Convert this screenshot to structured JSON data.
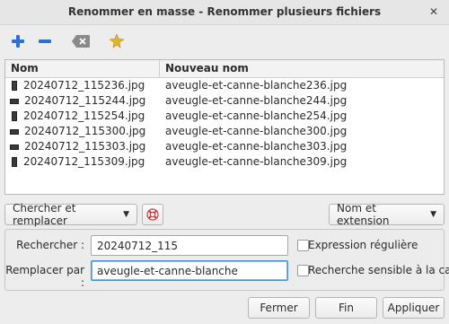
{
  "window": {
    "title": "Renommer en masse - Renommer plusieurs fichiers",
    "close_glyph": "✕"
  },
  "toolbar": {
    "icons": [
      "add-icon",
      "remove-icon",
      "clear-icon",
      "options-icon"
    ],
    "colors": {
      "add": "#2f6fd0",
      "remove": "#2f6fd0",
      "clear": "#8a8a8a",
      "options": "#e3b52b"
    }
  },
  "file_list": {
    "columns": [
      "Nom",
      "Nouveau nom"
    ],
    "rows": [
      {
        "name": "20240712_115236.jpg",
        "new_name": "aveugle-et-canne-blanche236.jpg",
        "thumb": "portrait"
      },
      {
        "name": "20240712_115244.jpg",
        "new_name": "aveugle-et-canne-blanche244.jpg",
        "thumb": "landscape"
      },
      {
        "name": "20240712_115254.jpg",
        "new_name": "aveugle-et-canne-blanche254.jpg",
        "thumb": "portrait"
      },
      {
        "name": "20240712_115300.jpg",
        "new_name": "aveugle-et-canne-blanche300.jpg",
        "thumb": "landscape"
      },
      {
        "name": "20240712_115303.jpg",
        "new_name": "aveugle-et-canne-blanche303.jpg",
        "thumb": "landscape"
      },
      {
        "name": "20240712_115309.jpg",
        "new_name": "aveugle-et-canne-blanche309.jpg",
        "thumb": "portrait"
      }
    ]
  },
  "mode_select": {
    "selected": "Chercher et remplacer"
  },
  "scope_select": {
    "selected": "Nom et extension"
  },
  "search": {
    "label": "Rechercher :",
    "value": "20240712_115",
    "regex_label": "Expression régulière",
    "regex_checked": false
  },
  "replace": {
    "label": "Remplacer par :",
    "value": "aveugle-et-canne-blanche",
    "case_label": "Recherche sensible à la casse",
    "case_checked": false
  },
  "actions": {
    "close_label": "Fermer",
    "done_label": "Fin",
    "apply_label": "Appliquer"
  }
}
